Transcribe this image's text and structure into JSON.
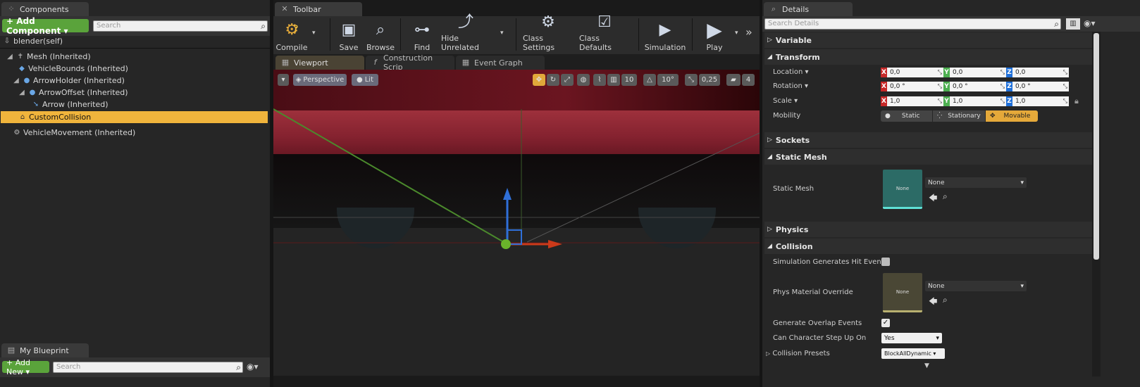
{
  "components": {
    "tab": "Components",
    "add_button": "+ Add Component ▾",
    "search_placeholder": "Search",
    "self_label": "blender(self)",
    "tree": [
      {
        "label": "Mesh (Inherited)",
        "indent": 0
      },
      {
        "label": "VehicleBounds (Inherited)",
        "indent": 1
      },
      {
        "label": "ArrowHolder (Inherited)",
        "indent": 1
      },
      {
        "label": "ArrowOffset (Inherited)",
        "indent": 2
      },
      {
        "label": "Arrow (Inherited)",
        "indent": 3
      },
      {
        "label": "CustomCollision",
        "indent": 1
      },
      {
        "label": "VehicleMovement (Inherited)",
        "indent": 0
      }
    ]
  },
  "my_blueprint": {
    "tab": "My Blueprint",
    "add_button": "+ Add New ▾",
    "search_placeholder": "Search"
  },
  "toolbar": {
    "tab": "Toolbar",
    "buttons": {
      "compile": "Compile",
      "save": "Save",
      "browse": "Browse",
      "find": "Find",
      "hide_unrelated": "Hide Unrelated",
      "class_settings": "Class Settings",
      "class_defaults": "Class Defaults",
      "simulation": "Simulation",
      "play": "Play"
    }
  },
  "editor_tabs": {
    "viewport": "Viewport",
    "construction": "Construction Scrip",
    "event_graph": "Event Graph"
  },
  "viewport": {
    "perspective": "Perspective",
    "lit": "Lit",
    "grid_snap": "10",
    "rot_snap": "10°",
    "scale_snap": "0,25",
    "camera_speed": "4"
  },
  "details": {
    "tab": "Details",
    "search_placeholder": "Search Details",
    "categories": {
      "variable": "Variable",
      "transform": "Transform",
      "sockets": "Sockets",
      "static_mesh": "Static Mesh",
      "physics": "Physics",
      "collision": "Collision"
    },
    "location": {
      "label": "Location ▾",
      "x": "0,0",
      "y": "0,0",
      "z": "0,0"
    },
    "rotation": {
      "label": "Rotation ▾",
      "x": "0,0 °",
      "y": "0,0 °",
      "z": "0,0 °"
    },
    "scale": {
      "label": "Scale ▾",
      "x": "1,0",
      "y": "1,0",
      "z": "1,0"
    },
    "axis_labels": {
      "x": "X",
      "y": "Y",
      "z": "Z"
    },
    "mobility": {
      "label": "Mobility",
      "static": "Static",
      "stationary": "Stationary",
      "movable": "Movable"
    },
    "static_mesh_label": "Static Mesh",
    "static_mesh_value": "None",
    "static_mesh_thumb": "None",
    "sim_hit_label": "Simulation Generates Hit Events",
    "phys_mat_label": "Phys Material Override",
    "phys_mat_value": "None",
    "phys_mat_thumb": "None",
    "overlap_label": "Generate Overlap Events",
    "step_up_label": "Can Character Step Up On",
    "step_up_value": "Yes",
    "presets_label": "Collision Presets",
    "presets_value": "BlockAllDynamic ▾"
  },
  "colors": {
    "selected_row": "#f0b43c",
    "add_green": "#5aa33b",
    "axis_x": "#c62828",
    "axis_y": "#4caf50",
    "axis_z": "#1e6fd9",
    "movable": "#e5a93a"
  }
}
